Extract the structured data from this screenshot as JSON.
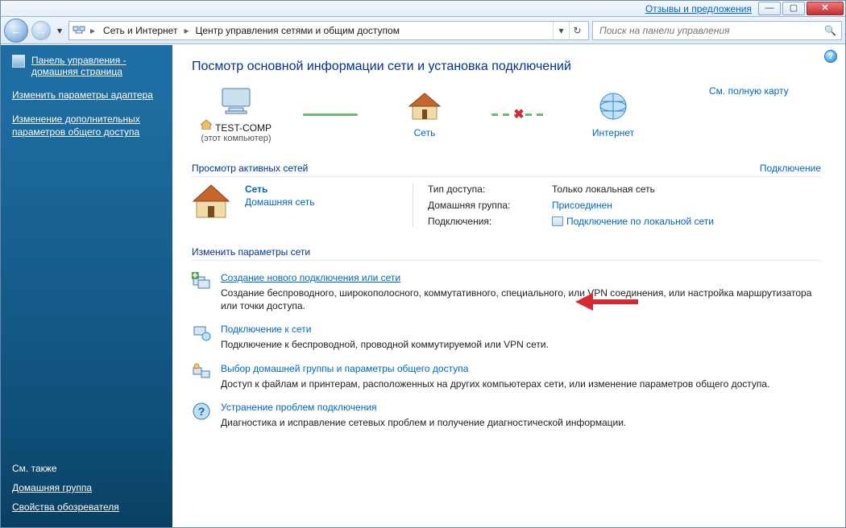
{
  "titlebar": {
    "feedback": "Отзывы и предложения"
  },
  "breadcrumb": {
    "seg1": "Сеть и Интернет",
    "seg2": "Центр управления сетями и общим доступом"
  },
  "search": {
    "placeholder": "Поиск на панели управления"
  },
  "sidebar": {
    "home": "Панель управления - домашняя страница",
    "links": {
      "0": "Изменить параметры адаптера",
      "1": "Изменение дополнительных параметров общего доступа"
    },
    "see_also": "См. также",
    "bottom": {
      "0": "Домашняя группа",
      "1": "Свойства обозревателя"
    }
  },
  "main": {
    "heading": "Посмотр основной информации сети и установка подключений",
    "full_map": "См. полную карту",
    "nodes": {
      "computer": "TEST-COMP",
      "computer_sub": "(этот компьютер)",
      "network": "Сеть",
      "internet": "Интернет"
    },
    "active_head": "Просмотр активных сетей",
    "connect_link": "Подключение",
    "net": {
      "name": "Сеть",
      "type": "Домашняя сеть"
    },
    "grid": {
      "access_label": "Тип доступа:",
      "access_value": "Только локальная сеть",
      "homegroup_label": "Домашняя группа:",
      "homegroup_value": "Присоединен",
      "connections_label": "Подключения:",
      "connections_value": "Подключение по локальной сети"
    },
    "change_head": "Изменить параметры сети",
    "tasks": {
      "0": {
        "title": "Создание нового подключения или сети",
        "desc": "Создание беспроводного, широкополосного, коммутативного, специального, или VPN соединения, или настройка маршрутизатора или точки доступа."
      },
      "1": {
        "title": "Подключение к сети",
        "desc": "Подключение к беспроводной, проводной коммутируемой или VPN сети."
      },
      "2": {
        "title": "Выбор домашней группы и параметры общего доступа",
        "desc": "Доступ к файлам и принтерам, расположенных на других компьютерах сети, или изменение параметров общего доступа."
      },
      "3": {
        "title": "Устранение проблем подключения",
        "desc": "Диагностика и исправление сетевых проблем и получение диагностической информации."
      }
    }
  }
}
